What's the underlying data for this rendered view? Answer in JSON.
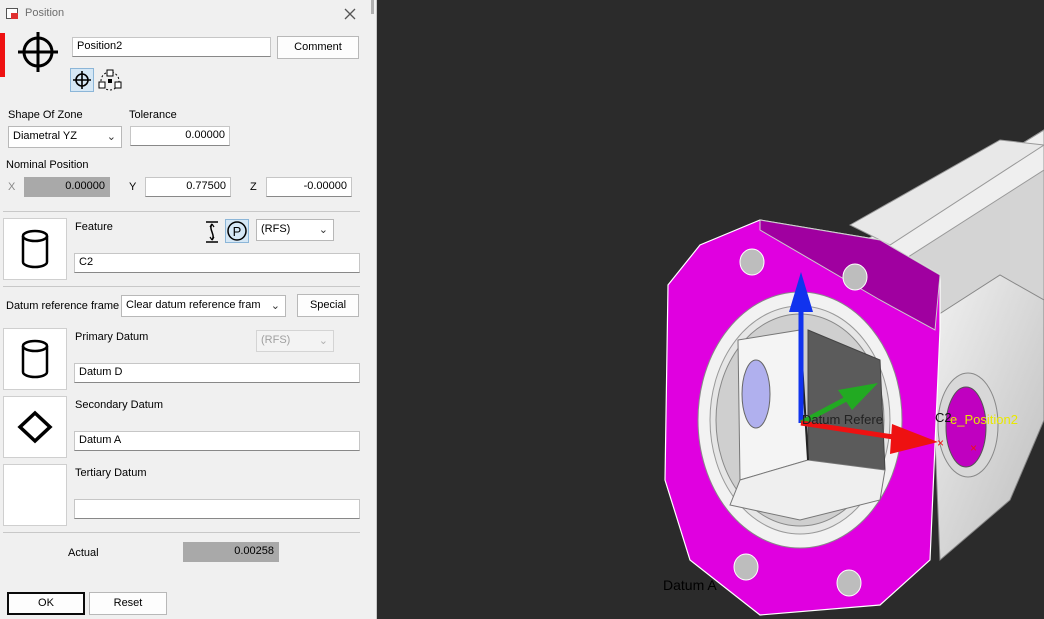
{
  "dialog": {
    "title": "Position",
    "name_value": "Position2",
    "comment_label": "Comment",
    "shape_label": "Shape Of Zone",
    "shape_value": "Diametral YZ",
    "tolerance_label": "Tolerance",
    "tolerance_value": "0.00000",
    "nominal_label": "Nominal Position",
    "x_label": "X",
    "x_value": "0.00000",
    "y_label": "Y",
    "y_value": "0.77500",
    "z_label": "Z",
    "z_value": "-0.00000",
    "feature_label": "Feature",
    "feature_modifier": "(RFS)",
    "feature_value": "C2",
    "datum_frame_label": "Datum reference frame",
    "datum_frame_value": "Clear datum reference fram",
    "special_label": "Special",
    "primary_label": "Primary Datum",
    "primary_modifier": "(RFS)",
    "primary_value": "Datum D",
    "secondary_label": "Secondary Datum",
    "secondary_value": "Datum A",
    "tertiary_label": "Tertiary Datum",
    "tertiary_value": "",
    "actual_label": "Actual",
    "actual_value": "0.00258",
    "ok_label": "OK",
    "reset_label": "Reset"
  },
  "viewport": {
    "label_datum_ref": "Datum Refere",
    "label_c2": "C2",
    "label_position": "e_Position2",
    "label_datum_a": "Datum A",
    "colors": {
      "background": "#2b2b2b",
      "highlight": "#e000e0",
      "part": "#e0e0e0",
      "axis_x": "#ee1111",
      "axis_y": "#22aa22",
      "axis_z": "#1133ee",
      "label_yellow": "#e8e800"
    }
  },
  "icons": [
    "position-icon",
    "close-icon",
    "position-mode-icon",
    "pattern-mode-icon",
    "cylinder-icon",
    "size-dimension-icon",
    "projected-zone-icon",
    "chevron-down-icon",
    "diamond-icon",
    "title-app-icon"
  ]
}
